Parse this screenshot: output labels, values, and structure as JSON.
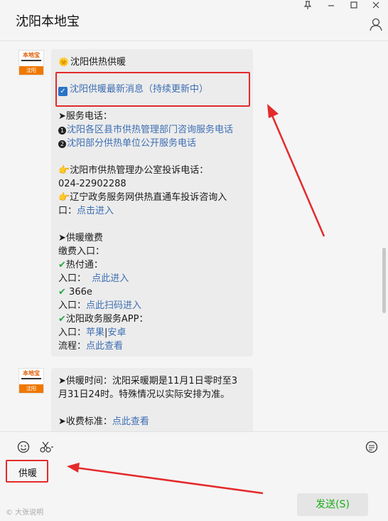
{
  "window": {
    "title": "沈阳本地宝",
    "controls": [
      "pin-icon",
      "minimize-icon",
      "maximize-icon",
      "close-icon"
    ]
  },
  "avatar": {
    "brand": "本地宝",
    "city": "沈阳"
  },
  "message1": {
    "title": "沈阳供热供暖",
    "headline_link": "沈阳供暖最新消息（持续更新中）",
    "hotline_label": "➤服务电话：",
    "hotline_links": [
      "沈阳各区县市供热管理部门咨询服务电话",
      "沈阳部分供热单位公开服务电话"
    ],
    "complaint_label": "沈阳市供热管理办公室投诉电话：",
    "complaint_phone": "024-22902288",
    "online_label_1": "辽宁政务服务网供热直通车投诉咨询入",
    "online_label_2": "口：",
    "online_link": "点击进入",
    "payment_heading": "➤供暖缴费",
    "payment_entry": "缴费入口：",
    "rft_label": "热付通：",
    "entry_label": "入口：",
    "rft_link": "点此进入",
    "e366_label": "366e",
    "e366_link": "点此扫码进入",
    "app_label": "沈阳政务服务APP：",
    "app_link_apple": "苹果",
    "app_sep": "|",
    "app_link_android": "安卓",
    "flow_label": "流程：",
    "flow_link": "点此查看"
  },
  "message2": {
    "time_line_1": "➤供暖时间：沈阳采暖期是11月1日零时至3",
    "time_line_2": "月31日24时。特殊情况以实际安排为准。",
    "fee_label": "➤收费标准：",
    "fee_link": "点此查看"
  },
  "input": {
    "text": "供暖",
    "send_label": "发送(S)"
  },
  "watermark": "© 大张说明"
}
